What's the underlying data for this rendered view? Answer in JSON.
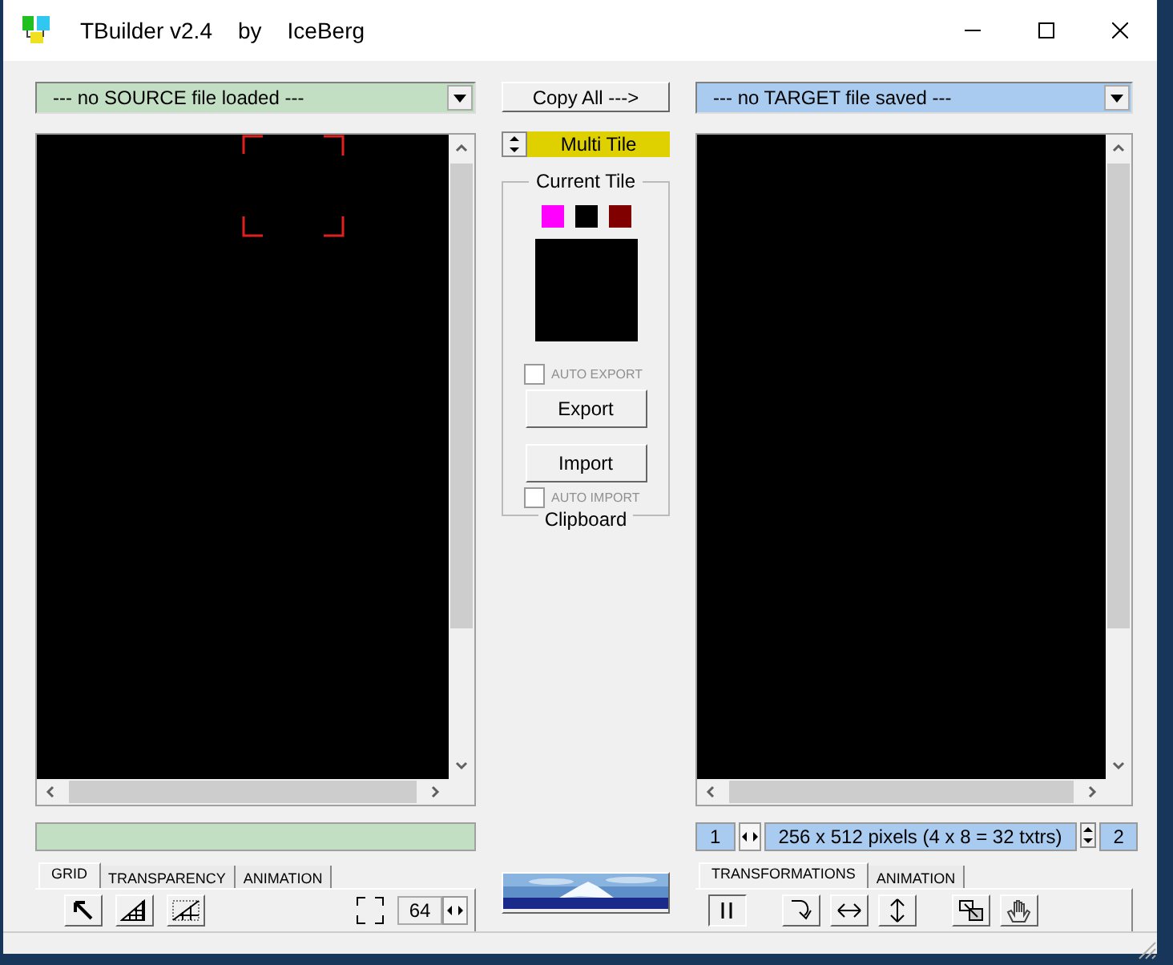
{
  "window": {
    "title_parts": [
      "TBuilder v2.4",
      "by",
      "IceBerg"
    ]
  },
  "source": {
    "combo": "--- no SOURCE file loaded ---"
  },
  "copy_all": "Copy All --->",
  "tile_mode": "Multi Tile",
  "current_tile": {
    "title": "Current Tile",
    "footer": "Clipboard",
    "swatches": [
      {
        "color": "#ff00ff"
      },
      {
        "color": "#000000"
      },
      {
        "color": "#800000"
      }
    ],
    "auto_export": {
      "label": "AUTO EXPORT",
      "checked": false,
      "disabled": true
    },
    "export": "Export",
    "import": "Import",
    "auto_import": {
      "label": "AUTO IMPORT",
      "checked": false,
      "disabled": true
    }
  },
  "target": {
    "combo": "--- no TARGET file saved ---",
    "page": "1",
    "info": "256 x 512 pixels (4 x 8 = 32 txtrs)",
    "count": "2"
  },
  "left_tabs": [
    {
      "label": "GRID",
      "selected": true
    },
    {
      "label": "TRANSPARENCY",
      "selected": false
    },
    {
      "label": "ANIMATION",
      "selected": false
    }
  ],
  "grid_size": "64",
  "right_tabs": [
    {
      "label": "TRANSFORMATIONS",
      "selected": true
    },
    {
      "label": "ANIMATION",
      "selected": false
    }
  ]
}
